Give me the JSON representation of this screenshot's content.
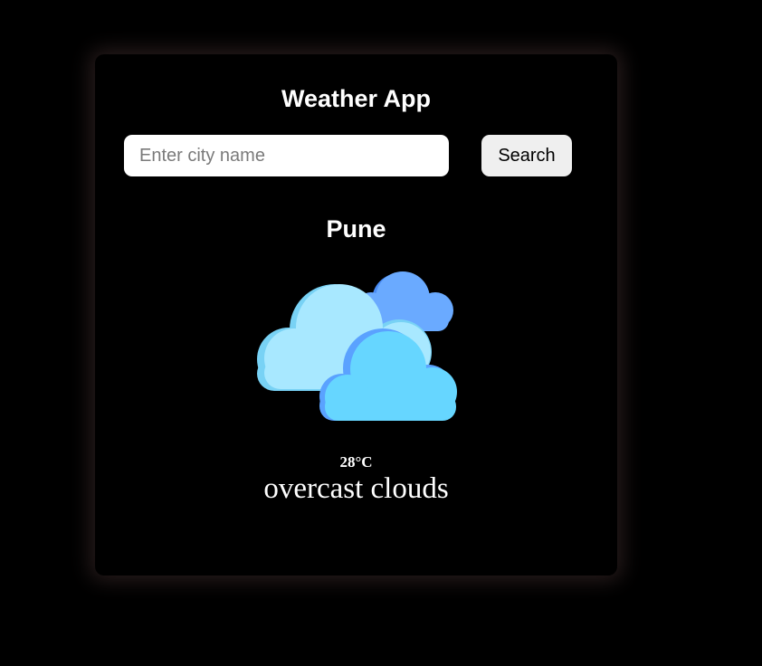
{
  "app": {
    "title": "Weather App"
  },
  "search": {
    "placeholder": "Enter city name",
    "value": "",
    "button_label": "Search"
  },
  "weather": {
    "city": "Pune",
    "temperature": "28°C",
    "description": "overcast clouds",
    "icon": "overcast-clouds-icon"
  },
  "colors": {
    "background": "#000000",
    "card": "#000000",
    "text": "#ffffff",
    "input_bg": "#ffffff",
    "button_bg": "#efefef",
    "cloud_back": "#5a9bff",
    "cloud_middle": "#a6e6ff",
    "cloud_front": "#66d4ff"
  }
}
